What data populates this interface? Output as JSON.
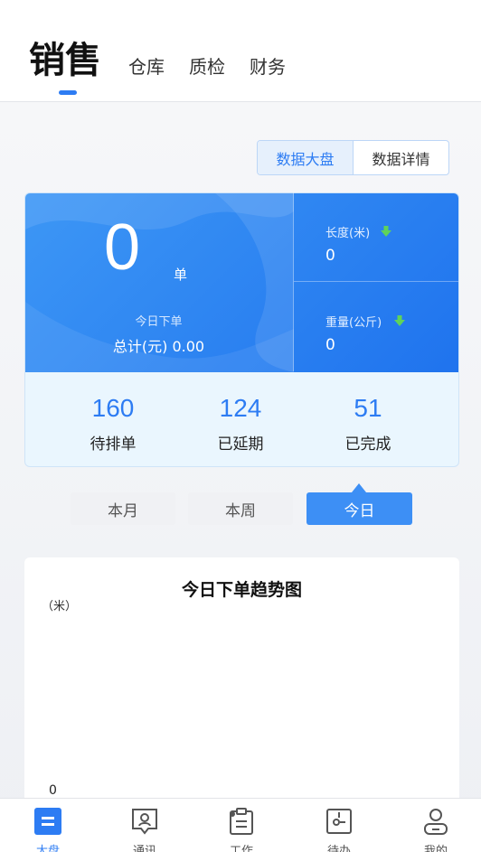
{
  "header": {
    "active_tab": "销售",
    "tabs": [
      "仓库",
      "质检",
      "财务"
    ]
  },
  "view_switch": {
    "options": [
      "数据大盘",
      "数据详情"
    ],
    "selected": "数据大盘"
  },
  "summary": {
    "order_count": "0",
    "order_unit": "单",
    "today_label": "今日下单",
    "total_label": "总计(元) 0.00",
    "metrics": [
      {
        "label": "长度(米)",
        "value": "0",
        "trend_icon": "arrow-down-icon"
      },
      {
        "label": "重量(公斤)",
        "value": "0",
        "trend_icon": "arrow-down-icon"
      }
    ],
    "stats": [
      {
        "value": "160",
        "label": "待排单"
      },
      {
        "value": "124",
        "label": "已延期"
      },
      {
        "value": "51",
        "label": "已完成"
      }
    ]
  },
  "period": {
    "options": [
      "本月",
      "本周",
      "今日"
    ],
    "selected": "今日"
  },
  "chart": {
    "title": "今日下单趋势图",
    "unit": "（米）",
    "zero_tick": "0"
  },
  "bottom_nav": [
    {
      "label": "大盘",
      "icon": "dashboard-icon",
      "active": true
    },
    {
      "label": "通讯",
      "icon": "contacts-icon",
      "active": false
    },
    {
      "label": "工作",
      "icon": "clipboard-icon",
      "active": false
    },
    {
      "label": "待办",
      "icon": "todo-icon",
      "active": false
    },
    {
      "label": "我的",
      "icon": "user-icon",
      "active": false
    }
  ],
  "colors": {
    "accent": "#2d7cf3",
    "card_gradient_start": "#3d97f5",
    "card_gradient_end": "#1f73ee",
    "trend_down": "#5fd35a"
  }
}
